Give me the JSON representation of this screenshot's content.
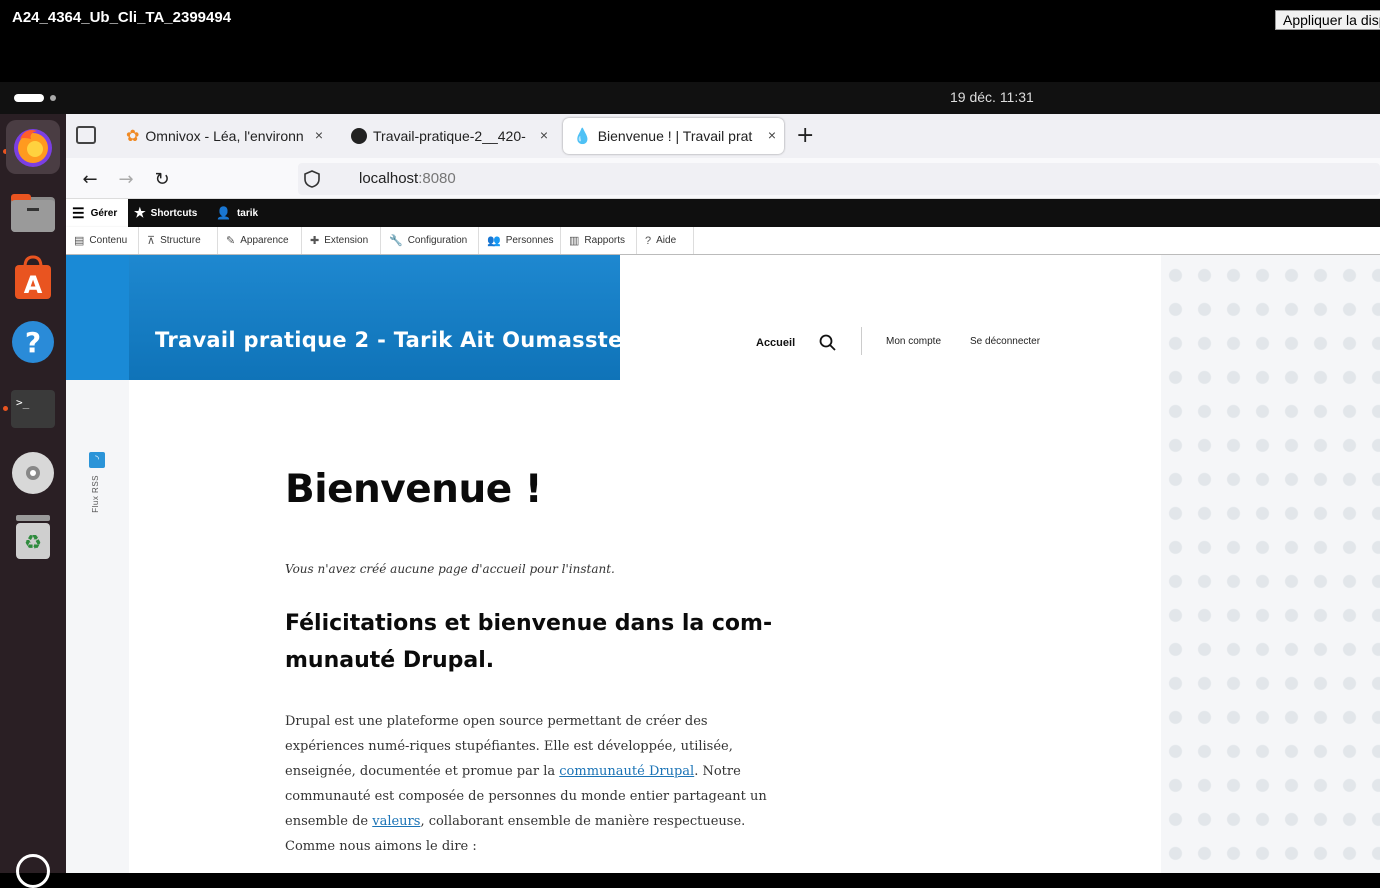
{
  "vm": {
    "title": "A24_4364_Ub_Cli_TA_2399494",
    "apply_label": "Appliquer la disp"
  },
  "panel": {
    "clock": "19 déc.  11:31"
  },
  "dock": {
    "items": [
      {
        "name": "firefox-icon",
        "glyph": "🦊"
      },
      {
        "name": "files-icon",
        "glyph": "🗀"
      },
      {
        "name": "app-center-icon",
        "glyph": "A"
      },
      {
        "name": "help-icon",
        "glyph": "?"
      },
      {
        "name": "terminal-icon",
        "glyph": ">_"
      },
      {
        "name": "disc-icon",
        "glyph": "◉"
      },
      {
        "name": "trash-icon",
        "glyph": "♻"
      }
    ]
  },
  "browser": {
    "tabs": [
      {
        "label": "Omnivox - Léa, l'environn",
        "close": "×"
      },
      {
        "label": "Travail-pratique-2__420-",
        "close": "×"
      },
      {
        "label": "Bienvenue ! | Travail prat",
        "close": "×"
      }
    ],
    "new_tab": "+",
    "url_host": "localhost",
    "url_port": ":8080"
  },
  "toolbar": {
    "gerer": "Gérer",
    "shortcuts": "Shortcuts",
    "user": "tarik",
    "tray": [
      "Contenu",
      "Structure",
      "Apparence",
      "Extension",
      "Configuration",
      "Personnes",
      "Rapports",
      "Aide"
    ]
  },
  "site": {
    "title": "Travail pratique 2 - Tarik Ait Oumasste",
    "nav_home": "Accueil",
    "nav_account": "Mon compte",
    "nav_logout": "Se déconnecter",
    "rss_label": "Flux RSS"
  },
  "content": {
    "h1": "Bienvenue !",
    "intro": "Vous n'avez créé aucune page d'accueil pour l'instant.",
    "h2_line1": "Félicitations et bienvenue dans la com-",
    "h2_line2": "munauté Drupal.",
    "p_part1": "Drupal est une plateforme open source permettant de créer des expériences numé-riques stupéfiantes. Elle est développée, utilisée, enseignée, documentée et promue par la ",
    "p_link1": "communauté Drupal",
    "p_part2": ". Notre communauté est composée de personnes du monde entier partageant un ensemble de ",
    "p_link2": "valeurs",
    "p_part3": ", collaborant ensemble de manière respectueuse. Comme nous aimons le dire :"
  }
}
